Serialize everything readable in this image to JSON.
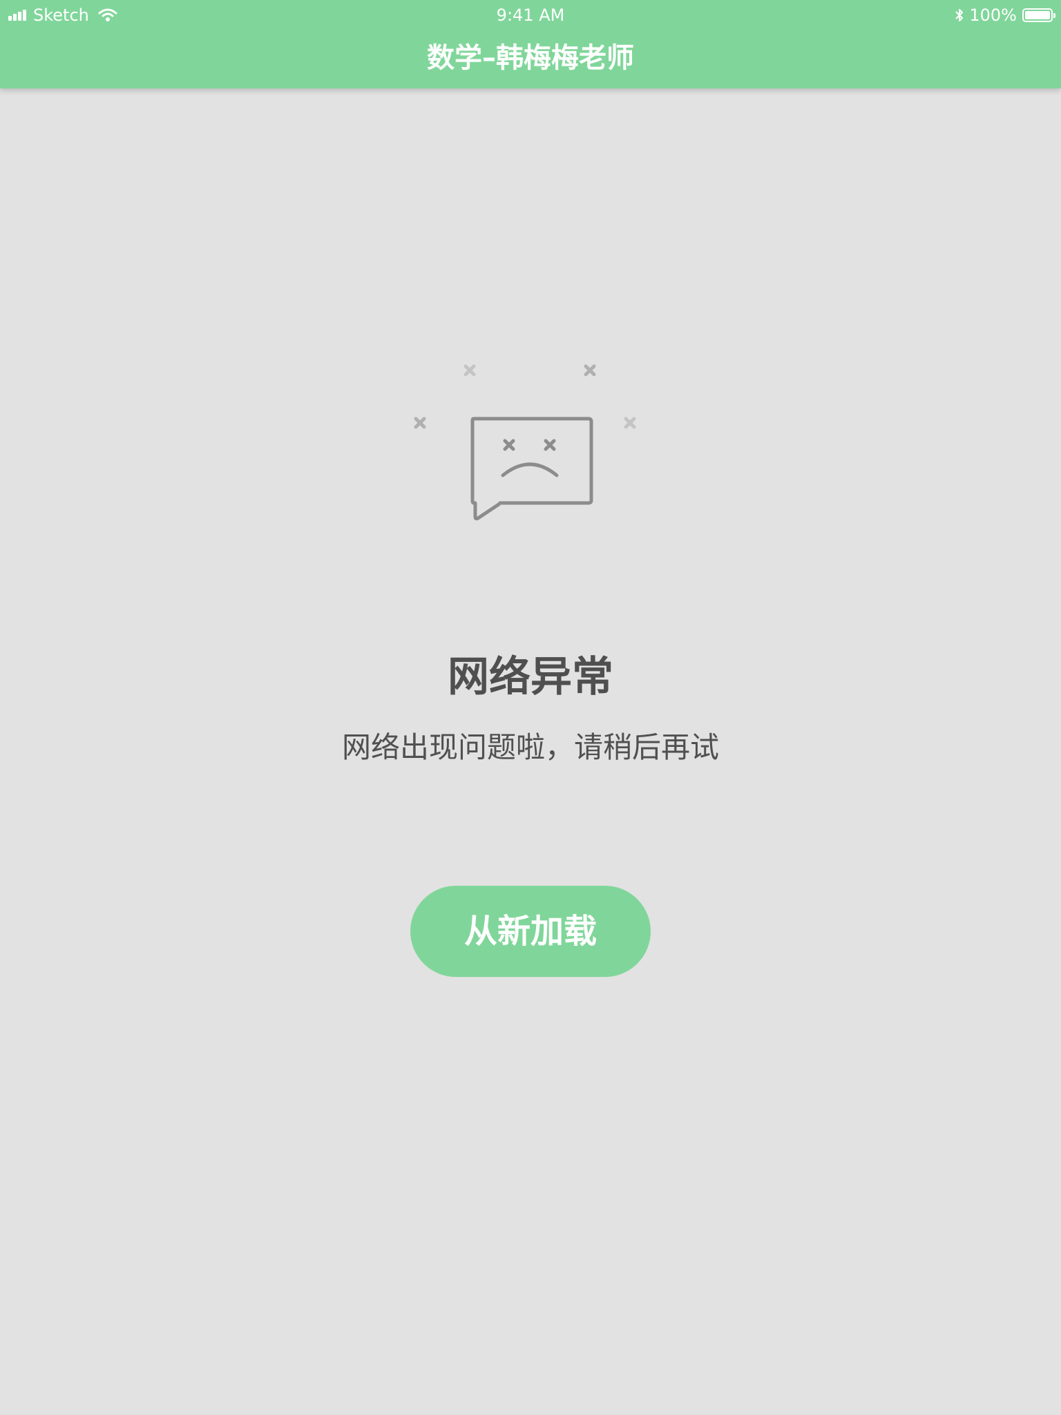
{
  "status_bar": {
    "carrier": "Sketch",
    "time": "9:41 AM",
    "battery": "100%",
    "icons": [
      "signal-icon",
      "wifi-icon",
      "bluetooth-icon",
      "battery-icon"
    ]
  },
  "nav": {
    "title": "数学–韩梅梅老师"
  },
  "error": {
    "illustration_icon": "sad-message-bubble-icon",
    "title": "网络异常",
    "message": "网络出现问题啦，请稍后再试"
  },
  "reload_button": {
    "label": "从新加载"
  },
  "colors": {
    "accent": "#80d69a",
    "background": "#e2e2e2",
    "text": "#4f4f4f",
    "icon": "#8c8c8c"
  }
}
